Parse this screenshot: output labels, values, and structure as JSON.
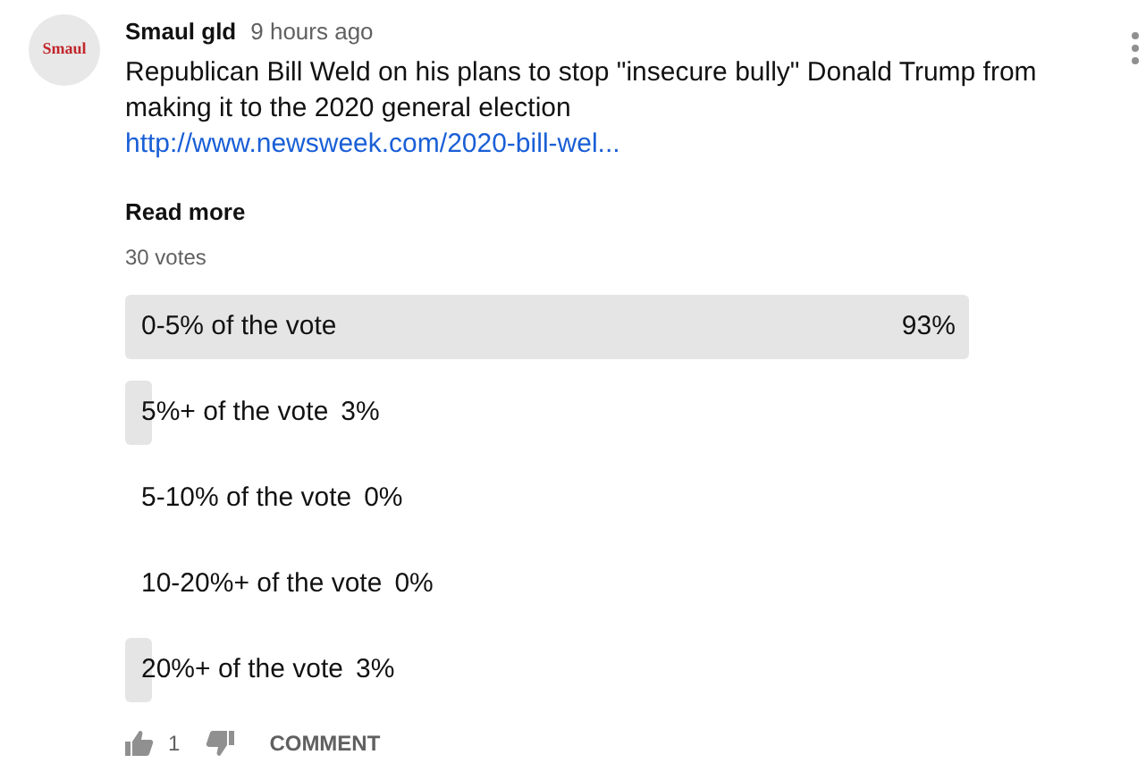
{
  "comment": {
    "avatar_text": "Smaul",
    "author": "Smaul gld",
    "time": "9 hours ago",
    "text": "Republican Bill Weld on his plans to stop \"insecure bully\" Donald Trump from making it to the 2020 general election",
    "link": "http://www.newsweek.com/2020-bill-wel...",
    "read_more": "Read more",
    "votes": "30 votes"
  },
  "poll": [
    {
      "label": "0-5% of the vote",
      "percent": "93%",
      "level": 0.93
    },
    {
      "label": "5%+ of the vote",
      "percent": "3%",
      "level": 0.03
    },
    {
      "label": "5-10% of the vote",
      "percent": "0%",
      "level": 0
    },
    {
      "label": "10-20%+ of the vote",
      "percent": "0%",
      "level": 0
    },
    {
      "label": "20%+ of the vote",
      "percent": "3%",
      "level": 0.03
    }
  ],
  "actions": {
    "likes": "1",
    "comment": "COMMENT"
  }
}
